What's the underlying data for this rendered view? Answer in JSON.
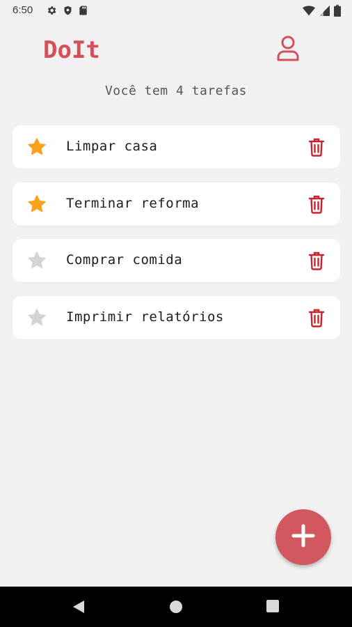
{
  "status_bar": {
    "time": "6:50"
  },
  "header": {
    "app_title": "DoIt"
  },
  "subtitle": "Você tem 4 tarefas",
  "tasks": [
    {
      "label": "Limpar casa",
      "favorite": true
    },
    {
      "label": "Terminar reforma",
      "favorite": true
    },
    {
      "label": "Comprar comida",
      "favorite": false
    },
    {
      "label": "Imprimir relatórios",
      "favorite": false
    }
  ],
  "colors": {
    "accent": "#d1505c",
    "star_active": "#f7a21b",
    "star_inactive": "#d4d4d4",
    "delete": "#c8242e",
    "fab": "#d1585f"
  },
  "icons": {
    "profile": "user-icon",
    "star": "star-icon",
    "delete": "trash-icon",
    "fab": "plus-icon"
  }
}
